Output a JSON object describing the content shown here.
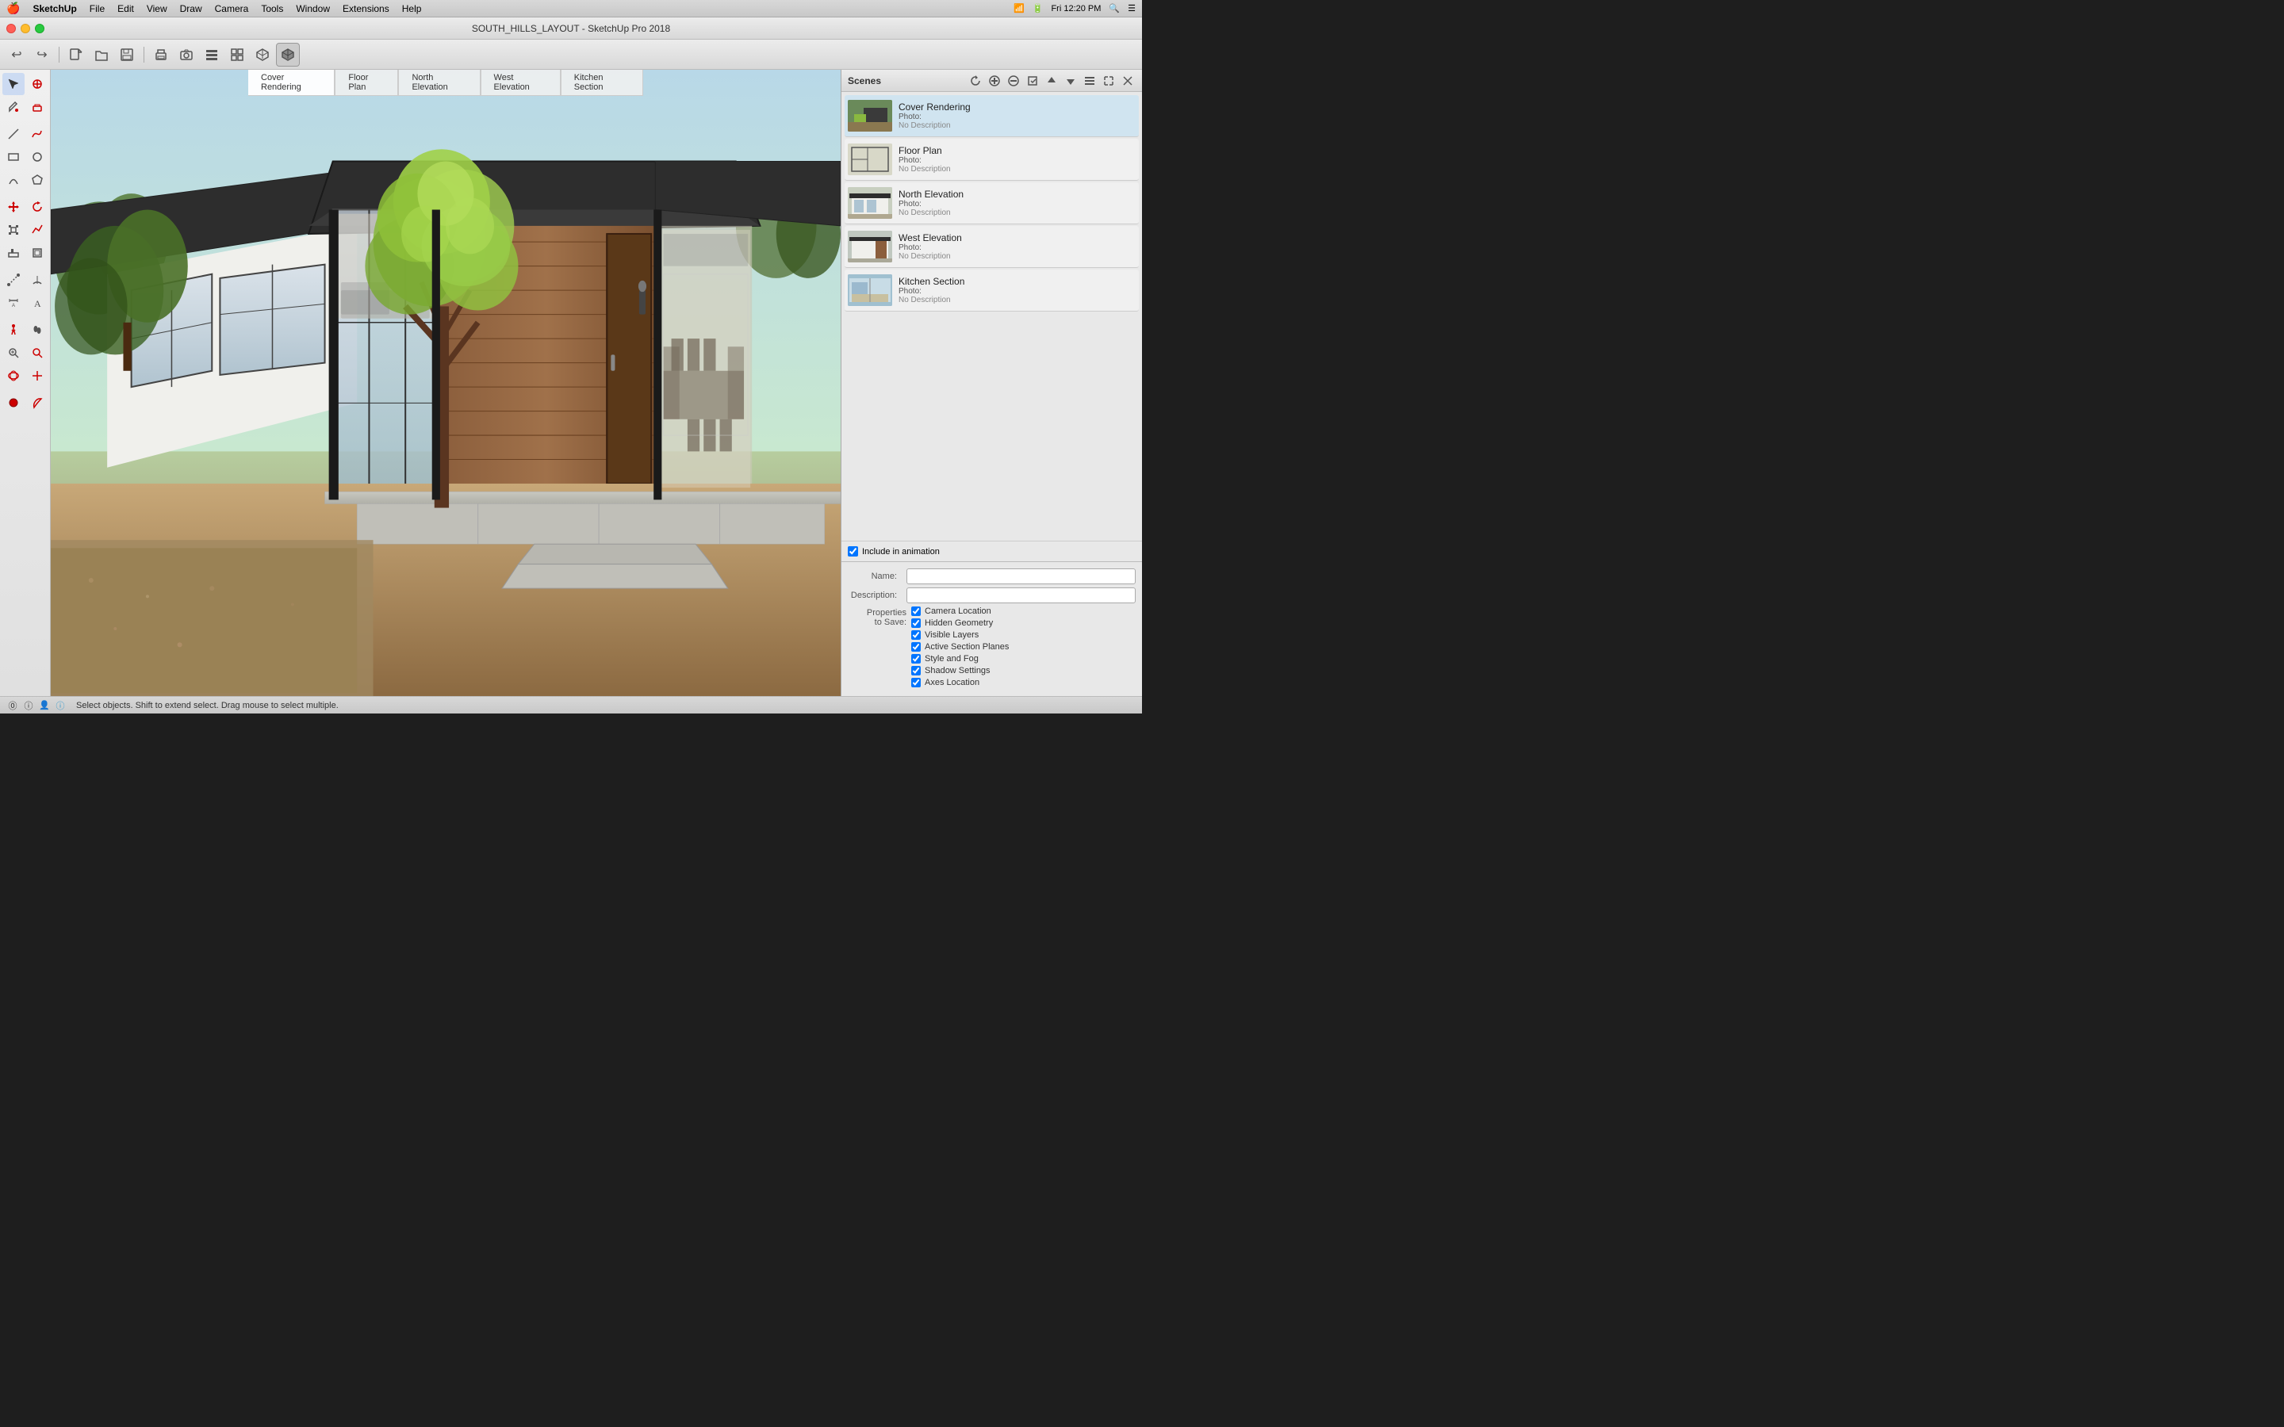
{
  "app": {
    "name": "SketchUp",
    "title": "SOUTH_HILLS_LAYOUT - SketchUp Pro 2018"
  },
  "menubar": {
    "apple": "🍎",
    "items": [
      "SketchUp",
      "File",
      "Edit",
      "View",
      "Draw",
      "Camera",
      "Tools",
      "Window",
      "Extensions",
      "Help"
    ],
    "time": "Fri 12:20 PM"
  },
  "toolbar": {
    "buttons": [
      "↩",
      "↪",
      "🏠",
      "📁",
      "📂",
      "💾",
      "🔲",
      "✏️",
      "📐",
      "📏",
      "⬛"
    ]
  },
  "viewport_tabs": [
    {
      "label": "Cover Rendering",
      "active": false
    },
    {
      "label": "Floor Plan",
      "active": false
    },
    {
      "label": "North Elevation",
      "active": false
    },
    {
      "label": "West Elevation",
      "active": false
    },
    {
      "label": "Kitchen Section",
      "active": false
    }
  ],
  "scenes_panel": {
    "title": "Scenes",
    "scenes": [
      {
        "id": "cover",
        "name": "Cover Rendering",
        "subtitle": "Photo:",
        "description": "No Description",
        "thumb_class": "thumb-cover"
      },
      {
        "id": "floor",
        "name": "Floor Plan",
        "subtitle": "Photo:",
        "description": "No Description",
        "thumb_class": "thumb-floor"
      },
      {
        "id": "north",
        "name": "North Elevation",
        "subtitle": "Photo:",
        "description": "No Description",
        "thumb_class": "thumb-north"
      },
      {
        "id": "west",
        "name": "West Elevation",
        "subtitle": "Photo:",
        "description": "No Description",
        "thumb_class": "thumb-west"
      },
      {
        "id": "kitchen",
        "name": "Kitchen Section",
        "subtitle": "Photo:",
        "description": "No Description",
        "thumb_class": "thumb-kitchen"
      }
    ]
  },
  "properties": {
    "include_animation_label": "Include in animation",
    "name_label": "Name:",
    "description_label": "Description:",
    "properties_to_save_label": "Properties\nto Save:",
    "checkboxes": [
      {
        "id": "camera_location",
        "label": "Camera Location",
        "checked": true
      },
      {
        "id": "hidden_geometry",
        "label": "Hidden Geometry",
        "checked": true
      },
      {
        "id": "visible_layers",
        "label": "Visible Layers",
        "checked": true
      },
      {
        "id": "active_section",
        "label": "Active Section Planes",
        "checked": true
      },
      {
        "id": "style_fog",
        "label": "Style and Fog",
        "checked": true
      },
      {
        "id": "shadow_settings",
        "label": "Shadow Settings",
        "checked": true
      },
      {
        "id": "axes_location",
        "label": "Axes Location",
        "checked": true
      }
    ]
  },
  "status_bar": {
    "message": "Select objects. Shift to extend select. Drag mouse to select multiple."
  }
}
